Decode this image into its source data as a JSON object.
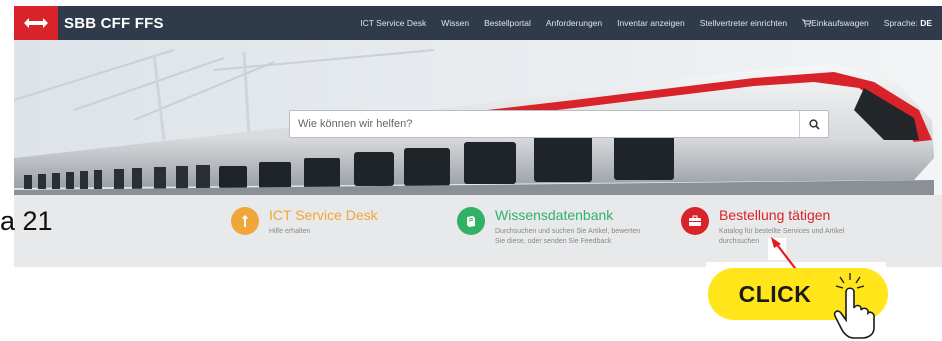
{
  "brand": {
    "name": "SBB CFF FFS",
    "icon": "sbb-logo-arrows",
    "color": "#d8232a"
  },
  "nav": {
    "items": [
      "ICT Service Desk",
      "Wissen",
      "Bestellportal",
      "Anforderungen",
      "Inventar anzeigen",
      "Stellvertreter einrichten"
    ],
    "cart_label": "Einkaufswagen",
    "language_label": "Sprache:",
    "language_value": "DE"
  },
  "search": {
    "placeholder": "Wie können wir helfen?",
    "icon": "search-icon"
  },
  "edge_text": "a 21",
  "tiles": [
    {
      "title": "ICT Service Desk",
      "desc": "Hilfe erhalten",
      "icon": "key-icon",
      "color": "#f0a63a"
    },
    {
      "title": "Wissensdatenbank",
      "desc": "Durchsuchen und suchen Sie Artikel, bewerten Sie diese, oder senden Sie Feedback",
      "icon": "book-icon",
      "color": "#31b165"
    },
    {
      "title": "Bestellung tätigen",
      "desc": "Katalog für bestellte Services und Artikel durchsuchen",
      "icon": "briefcase-icon",
      "color": "#d8232a"
    }
  ],
  "callout": {
    "label": "CLICK",
    "icon": "hand-pointer-icon",
    "arrow_color": "#e31b1b",
    "badge_color": "#ffe51a"
  }
}
